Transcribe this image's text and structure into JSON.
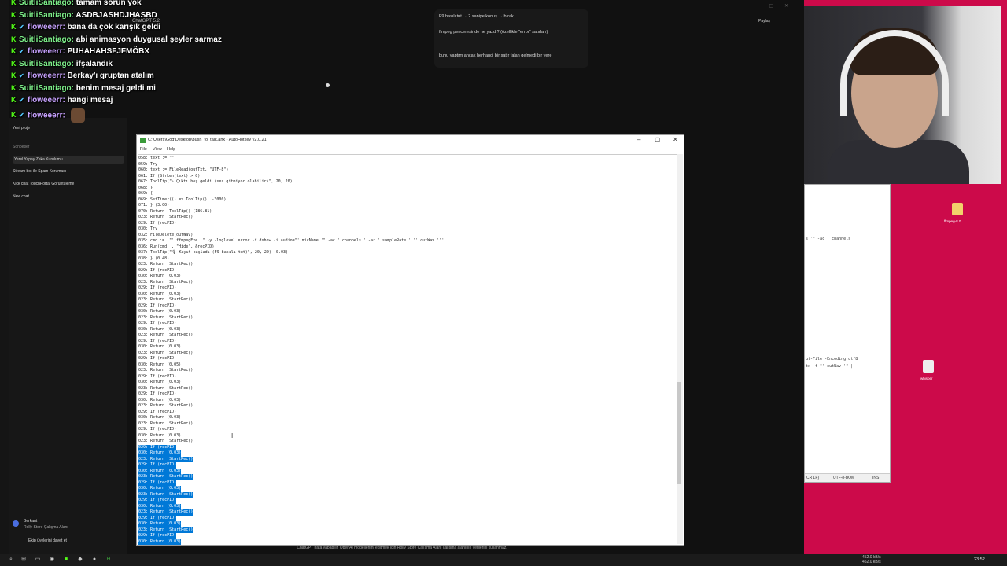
{
  "chat": [
    {
      "user": "SuitliSantiago",
      "text": "tamam sorun yok",
      "color": "u1",
      "badge": false
    },
    {
      "user": "SuitliSantiago",
      "text": "ASDBJASHDJHASBD",
      "color": "u1",
      "badge": false
    },
    {
      "user": "floweeerr",
      "text": "bana da çok karışık geldi",
      "color": "u2",
      "badge": true
    },
    {
      "user": "SuitliSantiago",
      "text": "abi animasyon duygusal şeyler sarmaz",
      "color": "u1",
      "badge": false
    },
    {
      "user": "floweeerr",
      "text": "PUHAHAHSFJFMÖBX",
      "color": "u2",
      "badge": true
    },
    {
      "user": "SuitliSantiago",
      "text": "ifşalandık",
      "color": "u1",
      "badge": false
    },
    {
      "user": "floweeerr",
      "text": "Berkay'ı gruptan atalım",
      "color": "u2",
      "badge": true
    },
    {
      "user": "SuitliSantiago",
      "text": "benim mesaj geldi mi",
      "color": "u1",
      "badge": false
    },
    {
      "user": "floweeerr",
      "text": "hangi mesaj",
      "color": "u2",
      "badge": true
    },
    {
      "user": "floweeerr",
      "text": "",
      "color": "u2",
      "badge": true,
      "emote": true
    }
  ],
  "gpt": {
    "title": "ChatGPT 5.2",
    "share": "Paylaş",
    "messages": [
      "F9 basılı tut → 2 saniye konuş → bırak",
      "ffmpeg penceresinde ne yazdı? (özellikle \"error\" satırları)",
      "bunu yaptım ancak herhangi bir satır falan gelmedi bir yere"
    ],
    "sidebar_top": "Yeni proje",
    "sidebar_heading": "Sohbetler",
    "sidebar_items": [
      "Yerel Yapay Zeka Kurulumu",
      "Stream bot ile Spam Koruması",
      "Kick chat TouchPortal Görüntüleme",
      "New chat"
    ],
    "profile_name": "Berkant",
    "profile_sub": "Rolly Store Çalışma Alanı",
    "invite": "Ekip üyelerini davet et",
    "disclaimer": "ChatGPT hata yapabilir. OpenAI modellerimi eğitmek için Rolly Store Çalışma Alanı çalışma alanının verilerini kullanmaz."
  },
  "ahk": {
    "title": "C:\\Users\\God\\Desktop\\push_to_talk.ahk - AutoHotkey v2.0.21",
    "menu": [
      "File",
      "View",
      "Help"
    ],
    "lines": [
      "058: text := \"\"",
      "059: Try",
      "060: text := FileRead(outTxt, \"UTF-8\")",
      "061: If (StrLen(text) > 0)",
      "067: ToolTip(\"⚠ Çıktı boş geldi (ses gitmiyor olabilir)\", 20, 20)",
      "068: }",
      "069: {",
      "069: SetTimer(() => ToolTip(), -3000)",
      "071: } (3.00)",
      "070: Return  ToolTip() (186.81)",
      "023: Return  StartRec()",
      "029: If (recPID)",
      "030: Try",
      "032: FileDelete(outWav)",
      "035: cmd := '\"' ffmpegExe '\" -y -loglevel error -f dshow -i audio=\"' micName '\" -ac ' channels ' -ar ' sampleRate ' \"' outWav '\"'",
      "036: Run(cmd, , \"Hide\", &recPID)",
      "037: ToolTip(\"🎙 Kayıt başladı (F9 basılı tut)\", 20, 20) (0.03)",
      "038: } (0.48)",
      "023: Return  StartRec()",
      "029: If (recPID)",
      "030: Return (0.03)",
      "023: Return  StartRec()",
      "029: If (recPID)",
      "030: Return (0.03)",
      "023: Return  StartRec()",
      "029: If (recPID)",
      "030: Return (0.03)",
      "023: Return  StartRec()",
      "029: If (recPID)",
      "030: Return (0.03)",
      "023: Return  StartRec()",
      "029: If (recPID)",
      "030: Return (0.03)",
      "023: Return  StartRec()",
      "029: If (recPID)",
      "030: Return (0.05)",
      "023: Return  StartRec()",
      "029: If (recPID)",
      "030: Return (0.03)",
      "023: Return  StartRec()",
      "029: If (recPID)",
      "030: Return (0.03)",
      "023: Return  StartRec()",
      "029: If (recPID)",
      "030: Return (0.03)",
      "023: Return  StartRec()",
      "029: If (recPID)",
      "030: Return (0.03)",
      "023: Return  StartRec()",
      "029: If (recPID)",
      "030: Return (0.03)",
      "023: Return  StartRec()",
      "029: If (recPID)",
      "030: Return (0.03)",
      "023: Return  StartRec()",
      "029: If (recPID)",
      "030: Return (0.03)",
      "023: Return  StartRec()",
      "029: If (recPID)",
      "030: Return (0.03)",
      "023: Return  StartRec()",
      "029: If (recPID)",
      "030: Return (0.03)",
      "023: Return  StartRec()",
      "029: If (recPID)",
      "030: Return (0.03)"
    ],
    "selected_from": 49
  },
  "notepad": {
    "line1": "s '\" -ac ' channels '",
    "line2": "ut-File -Encoding utf8",
    "line3": "tx -f \"' outWav '\" |",
    "status_pos": "CR LF)",
    "status_enc": "UTF-8-BOM",
    "status_ins": "INS"
  },
  "desktop": {
    "icon1": "ffmpeg-8.0...",
    "icon2": "whisper"
  },
  "tray": {
    "net_up": "452.0 kB/s",
    "net_down": "452.0 kB/s",
    "time": "23:52"
  }
}
